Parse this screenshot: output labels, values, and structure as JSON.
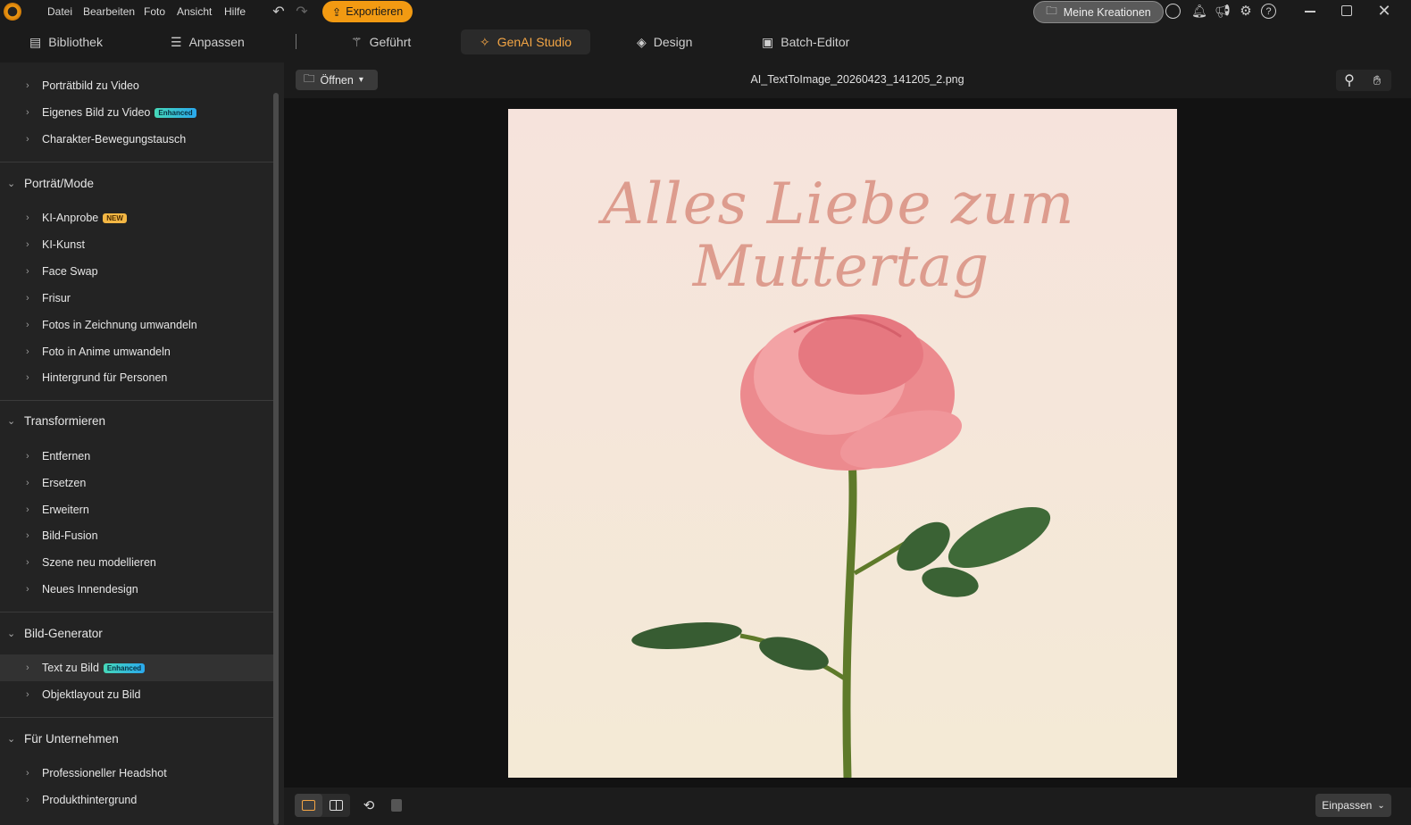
{
  "menu": {
    "items": [
      "Datei",
      "Bearbeiten",
      "Foto",
      "Ansicht",
      "Hilfe"
    ],
    "export_label": "Exportieren",
    "creations_label": "Meine Kreationen"
  },
  "tabs": [
    {
      "label": "Bibliothek"
    },
    {
      "label": "Anpassen"
    },
    {
      "label": "Geführt"
    },
    {
      "label": "GenAI Studio",
      "active": true
    },
    {
      "label": "Design"
    },
    {
      "label": "Batch-Editor"
    }
  ],
  "sidebar": {
    "top_items": [
      {
        "label": "Porträtbild zu Video"
      },
      {
        "label": "Eigenes Bild zu Video",
        "badge": "Enhanced"
      },
      {
        "label": "Charakter-Bewegungstausch"
      }
    ],
    "groups": [
      {
        "title": "Porträt/Mode",
        "items": [
          {
            "label": "KI-Anprobe",
            "badge": "NEW"
          },
          {
            "label": "KI-Kunst"
          },
          {
            "label": "Face Swap"
          },
          {
            "label": "Frisur"
          },
          {
            "label": "Fotos in Zeichnung umwandeln"
          },
          {
            "label": "Foto in Anime umwandeln"
          },
          {
            "label": "Hintergrund für Personen"
          }
        ]
      },
      {
        "title": "Transformieren",
        "items": [
          {
            "label": "Entfernen"
          },
          {
            "label": "Ersetzen"
          },
          {
            "label": "Erweitern"
          },
          {
            "label": "Bild-Fusion"
          },
          {
            "label": "Szene neu modellieren"
          },
          {
            "label": "Neues Innendesign"
          }
        ]
      },
      {
        "title": "Bild-Generator",
        "items": [
          {
            "label": "Text zu Bild",
            "badge": "Enhanced",
            "selected": true
          },
          {
            "label": "Objektlayout zu Bild"
          }
        ]
      },
      {
        "title": "Für Unternehmen",
        "items": [
          {
            "label": "Professioneller Headshot"
          },
          {
            "label": "Produkthintergrund"
          }
        ]
      }
    ]
  },
  "viewer": {
    "open_label": "Öffnen",
    "filename": "AI_TextToImage_20260423_141205_2.png",
    "zoom_label": "Einpassen"
  },
  "image": {
    "line1": "Alles Liebe zum",
    "line2": "Muttertag"
  },
  "colors": {
    "accent": "#f29a12",
    "active_tab": "#f3a545"
  }
}
